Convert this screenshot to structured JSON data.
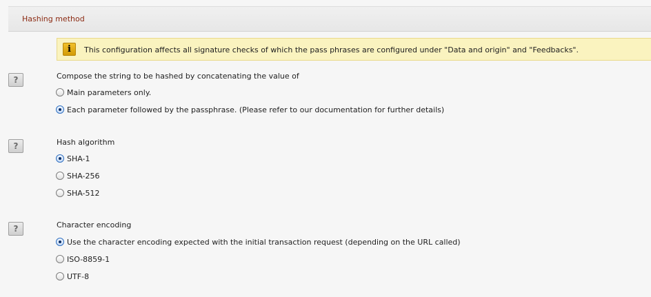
{
  "section": {
    "title": "Hashing method"
  },
  "info": {
    "icon": "info-icon",
    "icon_glyph": "i",
    "text": "This configuration affects all signature checks of which the pass phrases are configured under \"Data and origin\" and \"Feedbacks\"."
  },
  "help_button": {
    "icon": "question-mark-icon",
    "glyph": "?"
  },
  "groups": [
    {
      "label": "Compose the string to be hashed by concatenating the value of",
      "options": [
        {
          "label": "Main parameters only.",
          "checked": false
        },
        {
          "label": "Each parameter followed by the passphrase. (Please refer to our documentation for further details)",
          "checked": true
        }
      ]
    },
    {
      "label": "Hash algorithm",
      "options": [
        {
          "label": "SHA-1",
          "checked": true
        },
        {
          "label": "SHA-256",
          "checked": false
        },
        {
          "label": "SHA-512",
          "checked": false
        }
      ]
    },
    {
      "label": "Character encoding",
      "options": [
        {
          "label": "Use the character encoding expected with the initial transaction request (depending on the URL called)",
          "checked": true
        },
        {
          "label": "ISO-8859-1",
          "checked": false
        },
        {
          "label": "UTF-8",
          "checked": false
        }
      ]
    }
  ],
  "colors": {
    "title": "#8b2a12",
    "info_background": "#faf3bf",
    "info_icon": "#f2c12a",
    "radio_selected": "#2f6fc0"
  }
}
